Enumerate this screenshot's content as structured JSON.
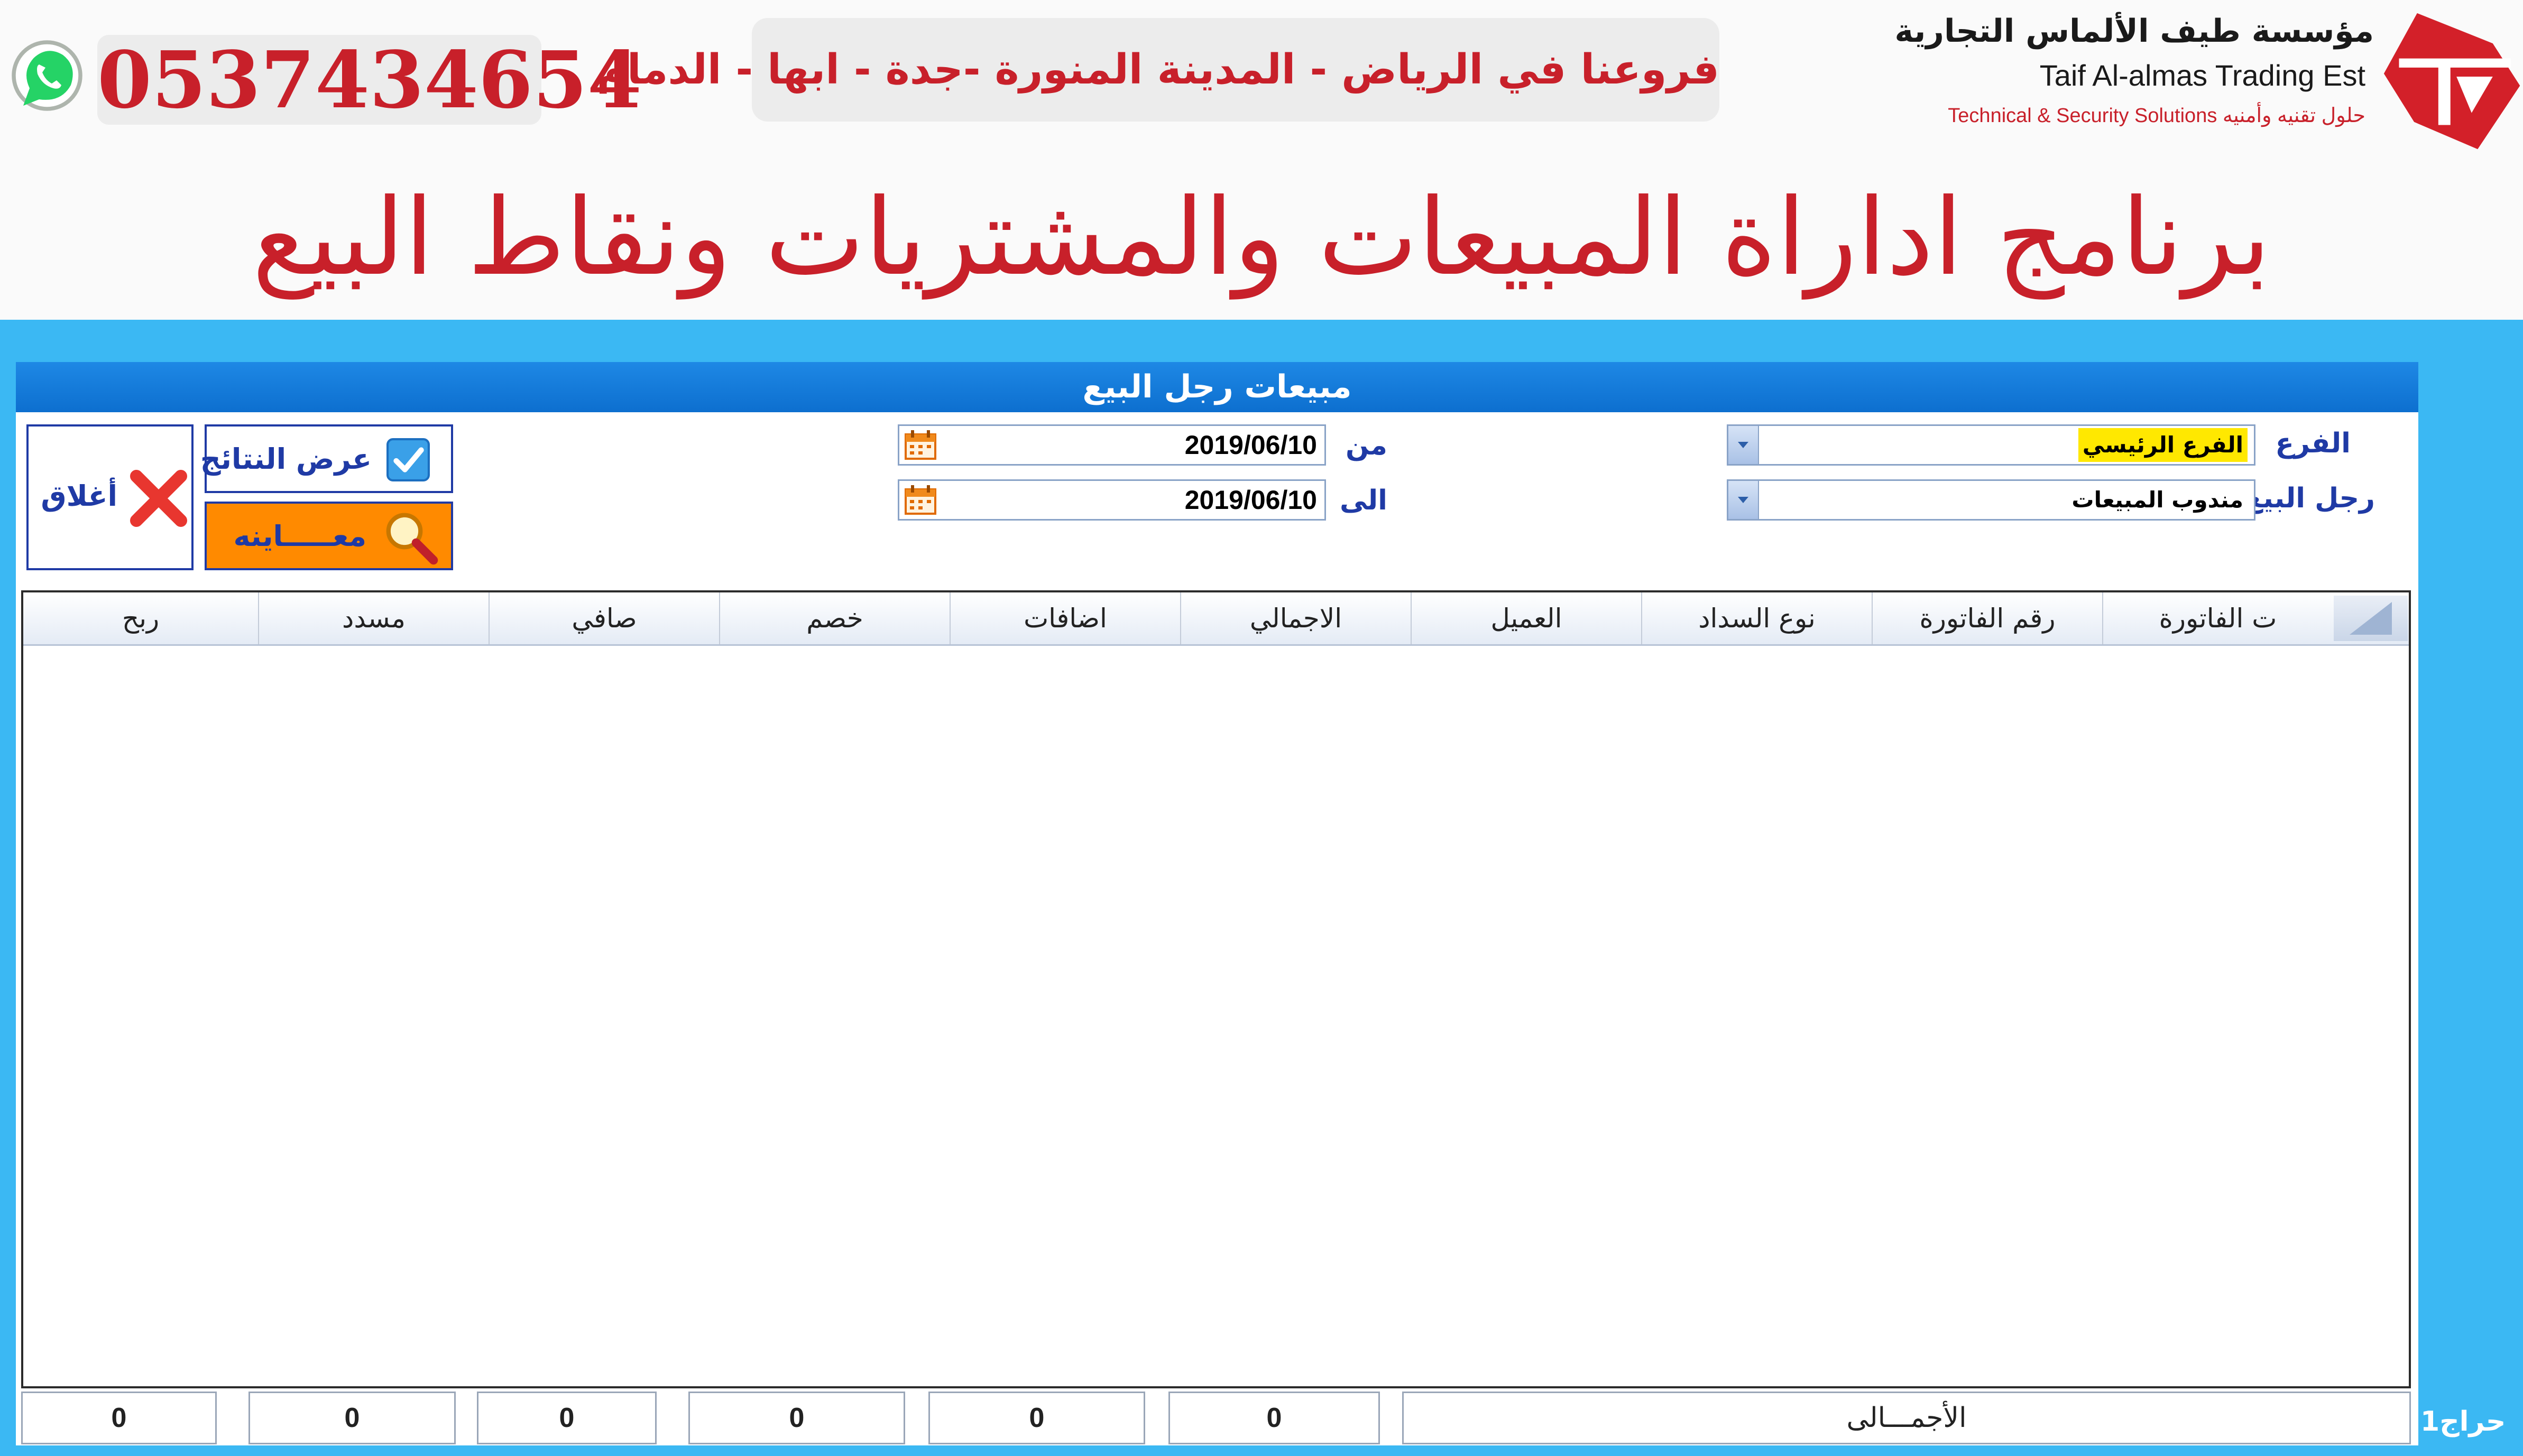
{
  "banner": {
    "phone": "0537434654",
    "branches": "فروعنا في الرياض - المدينة المنورة -جدة - ابها - الدمام",
    "company_ar": "مؤسسة طيف الألماس التجارية",
    "company_en": "Taif Al-almas Trading Est",
    "company_tagline": "Technical & Security Solutions حلول تقنيه وأمنيه",
    "main_title": "برنامج اداراة المبيعات والمشتريات ونقاط البيع",
    "icons": {
      "whatsapp": "whatsapp-icon",
      "logo": "company-logo"
    },
    "colors": {
      "brand_red": "#c8202a",
      "whatsapp_green": "#25d366"
    }
  },
  "window": {
    "title": "مبيعات رجل البيع",
    "filters": {
      "branch_label": "الفرع",
      "branch_value": "الفرع الرئيسي",
      "salesman_label": "رجل البيع",
      "salesman_value": "مندوب المبيعات",
      "from_label": "من",
      "from_date": "2019/06/10",
      "to_label": "الى",
      "to_date": "2019/06/10"
    },
    "buttons": {
      "show_results": "عرض النتائج",
      "preview": "معـــــاينه",
      "close": "أغلاق"
    },
    "grid": {
      "columns": [
        "ت الفاتورة",
        "رقم الفاتورة",
        "نوع السداد",
        "العميل",
        "الاجمالي",
        "اضافات",
        "خصم",
        "صافي",
        "مسدد",
        "ربح"
      ],
      "rows": []
    },
    "totals": {
      "label": "الأجمـــالى",
      "values": [
        "0",
        "0",
        "0",
        "0",
        "0",
        "0"
      ]
    }
  },
  "footer": {
    "tag": "حراج1"
  },
  "colors": {
    "app_bg": "#3bb8f3",
    "title_bar": "#1e88e5",
    "accent_orange": "#ff8a00",
    "label_blue": "#1f3aa5"
  }
}
